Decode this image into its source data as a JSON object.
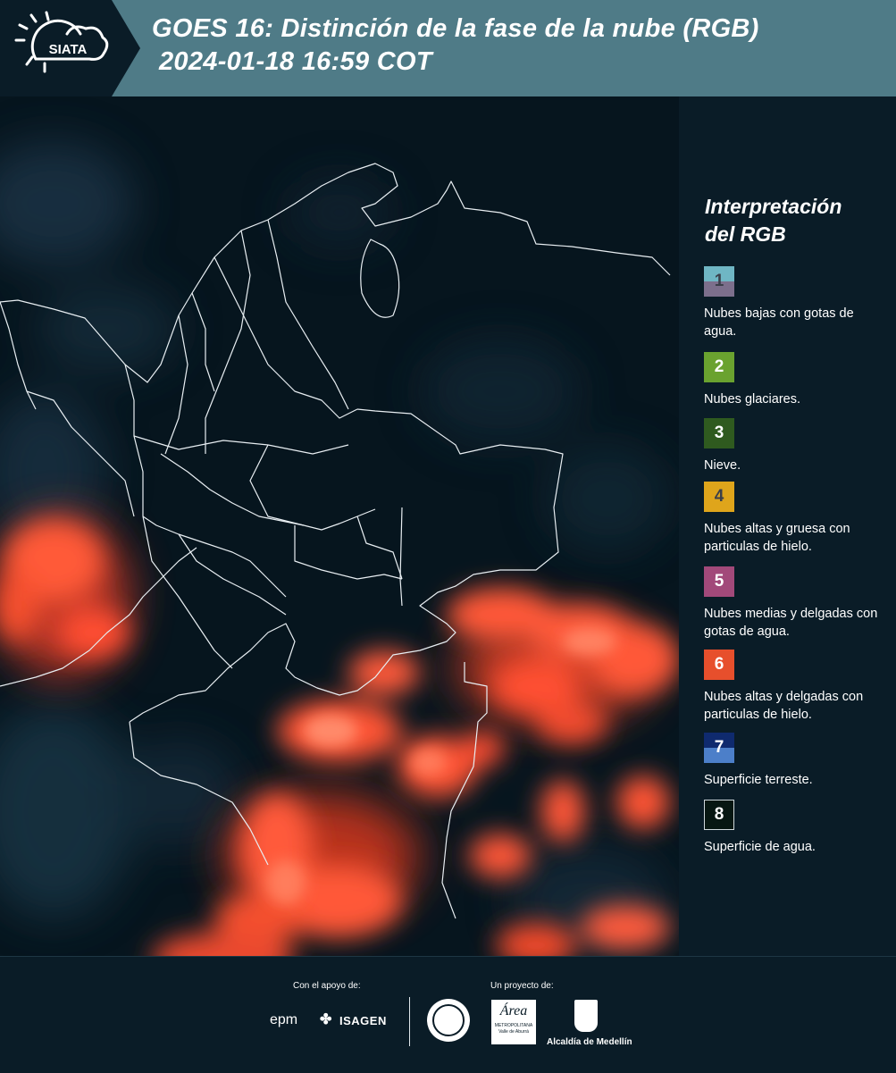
{
  "header": {
    "logo_text": "SIATA",
    "title_line1": "GOES 16: Distinción de la fase de la nube (RGB)",
    "title_line2": "2024-01-18 16:59 COT"
  },
  "legend": {
    "title_line1": "Interpretación",
    "title_line2": "del RGB",
    "items": [
      {
        "number": "1",
        "label": "Nubes bajas con gotas de agua.",
        "color_top": "#6fb6c4",
        "color_bottom": "#7c6f8c"
      },
      {
        "number": "2",
        "label": "Nubes glaciares.",
        "color": "#6aa22f"
      },
      {
        "number": "3",
        "label": "Nieve.",
        "color": "#2f5a1f"
      },
      {
        "number": "4",
        "label": "Nubes altas y gruesa con particulas de hielo.",
        "color": "#dfa51b"
      },
      {
        "number": "5",
        "label": "Nubes medias y delgadas con gotas de agua.",
        "color": "#a2497a"
      },
      {
        "number": "6",
        "label": "Nubes altas y delgadas con particulas de hielo.",
        "color": "#e74f2c"
      },
      {
        "number": "7",
        "label": "Superficie terreste.",
        "color_top": "#0f2a6e",
        "color_bottom": "#4c7fc9"
      },
      {
        "number": "8",
        "label": "Superficie de agua.",
        "color": "#071712"
      }
    ]
  },
  "footer": {
    "support_label": "Con el apoyo de:",
    "project_label": "Un proyecto de:",
    "sponsor_epm": "epm",
    "sponsor_isagen": "ISAGEN",
    "area_text": "Área",
    "area_sub1": "METROPOLITANA",
    "area_sub2": "Valle de Aburrá",
    "alcaldia_label": "Alcaldía de Medellín"
  }
}
